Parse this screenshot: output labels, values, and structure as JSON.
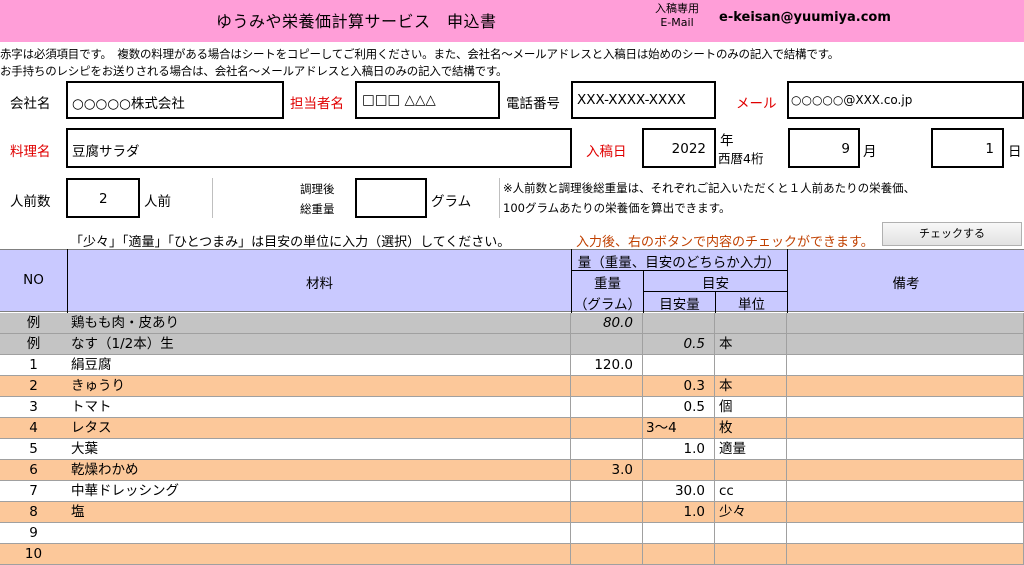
{
  "header": {
    "title": "ゆうみや栄養価計算サービス　申込書",
    "submit_label_1": "入稿専用",
    "submit_label_2": "E-Mail",
    "email": "e-keisan@yuumiya.com"
  },
  "notes": {
    "line1": "赤字は必須項目です。　複数の料理がある場合はシートをコピーしてご利用ください。また、会社名～メールアドレスと入稿日は始めのシートのみの記入で結構です。",
    "line2": "お手持ちのレシピをお送りされる場合は、会社名～メールアドレスと入稿日のみの記入で結構です。"
  },
  "form": {
    "company_label": "会社名",
    "company_value": "○○○○○株式会社",
    "person_label": "担当者名",
    "person_value": "□□□ △△△",
    "phone_label": "電話番号",
    "phone_value": "XXX-XXXX-XXXX",
    "mail_label": "メール",
    "mail_value": "○○○○○@XXX.co.jp",
    "dish_label": "料理名",
    "dish_value": "豆腐サラダ",
    "date_label": "入稿日",
    "year_value": "2022",
    "year_unit": "年",
    "year_hint": "西暦4桁",
    "month_value": "9",
    "month_unit": "月",
    "day_value": "1",
    "day_unit": "日",
    "servings_label": "人前数",
    "servings_value": "2",
    "servings_unit": "人前",
    "cooked_label_1": "調理後",
    "cooked_label_2": "総重量",
    "cooked_value": "",
    "cooked_unit": "グラム",
    "info_1": "※人前数と調理後総重量は、それぞれご記入いただくと１人前あたりの栄養価、",
    "info_2": "100グラムあたりの栄養価を算出できます。"
  },
  "instructions": {
    "unit_hint": "「少々」「適量」「ひとつまみ」は目安の単位に入力（選択）してください。",
    "check_hint": "入力後、右のボタンで内容のチェックができます。",
    "check_button": "チェックする"
  },
  "table": {
    "col_no": "NO",
    "col_material": "材料",
    "col_amount": "量（重量、目安のどちらか入力）",
    "col_weight": "重量",
    "col_weight_unit": "（グラム）",
    "col_guide": "目安",
    "col_guide_amount": "目安量",
    "col_guide_unit": "単位",
    "col_notes": "備考",
    "rows": [
      {
        "no": "例",
        "material": "鶏もも肉・皮あり",
        "weight": "80.0",
        "guide": "",
        "unit": "",
        "style": "gray"
      },
      {
        "no": "例",
        "material": "なす（1/2本）生",
        "weight": "",
        "guide": "0.5",
        "unit": "本",
        "style": "gray"
      },
      {
        "no": "1",
        "material": "絹豆腐",
        "weight": "120.0",
        "guide": "",
        "unit": "",
        "style": "white"
      },
      {
        "no": "2",
        "material": "きゅうり",
        "weight": "",
        "guide": "0.3",
        "unit": "本",
        "style": "orange"
      },
      {
        "no": "3",
        "material": "トマト",
        "weight": "",
        "guide": "0.5",
        "unit": "個",
        "style": "white"
      },
      {
        "no": "4",
        "material": "レタス",
        "weight": "",
        "guide": "3～4",
        "unit": "枚",
        "style": "orange"
      },
      {
        "no": "5",
        "material": "大葉",
        "weight": "",
        "guide": "1.0",
        "unit": "適量",
        "style": "white"
      },
      {
        "no": "6",
        "material": "乾燥わかめ",
        "weight": "3.0",
        "guide": "",
        "unit": "",
        "style": "orange"
      },
      {
        "no": "7",
        "material": "中華ドレッシング",
        "weight": "",
        "guide": "30.0",
        "unit": "cc",
        "style": "white"
      },
      {
        "no": "8",
        "material": "塩",
        "weight": "",
        "guide": "1.0",
        "unit": "少々",
        "style": "orange"
      },
      {
        "no": "9",
        "material": "",
        "weight": "",
        "guide": "",
        "unit": "",
        "style": "white"
      },
      {
        "no": "10",
        "material": "",
        "weight": "",
        "guide": "",
        "unit": "",
        "style": "orange"
      }
    ]
  },
  "colors": {
    "header_bg": "#ff9ed8",
    "table_header_bg": "#c9c9ff",
    "example_row_bg": "#c4c4c4",
    "alt_row_bg": "#fcc89a",
    "required_text": "#e00000",
    "hint_text": "#c04000"
  }
}
